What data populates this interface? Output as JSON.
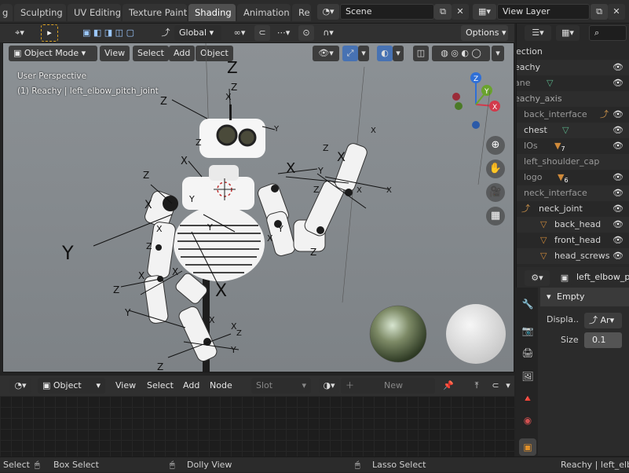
{
  "workspace_tabs": [
    "g",
    "Sculpting",
    "UV Editing",
    "Texture Paint",
    "Shading",
    "Animation",
    "Re"
  ],
  "active_tab": "Shading",
  "scene": {
    "label": "Scene"
  },
  "view_layer": {
    "label": "View Layer"
  },
  "viewport": {
    "transform_orientation": "Global",
    "mode": "Object Mode",
    "menus": [
      "View",
      "Select",
      "Add",
      "Object"
    ],
    "options_label": "Options",
    "overlay_line1": "User Perspective",
    "overlay_line2": "(1) Reachy | left_elbow_pitch_joint",
    "gizmo_labels": {
      "z": "Z",
      "y": "Y",
      "x": "X"
    }
  },
  "outliner": {
    "search_placeholder": "",
    "items": [
      {
        "label": "ection",
        "indent": 0
      },
      {
        "label": "eachy",
        "indent": 0
      },
      {
        "label": "ane",
        "indent": 0
      },
      {
        "label": "eachy_axis",
        "indent": 0
      },
      {
        "label": "back_interface",
        "indent": 1
      },
      {
        "label": "chest",
        "indent": 1
      },
      {
        "label": "IOs",
        "indent": 1,
        "badge": "7"
      },
      {
        "label": "left_shoulder_cap",
        "indent": 1
      },
      {
        "label": "logo",
        "indent": 1,
        "badge": "6"
      },
      {
        "label": "neck_interface",
        "indent": 1
      },
      {
        "label": "neck_joint",
        "indent": 1
      },
      {
        "label": "back_head",
        "indent": 2
      },
      {
        "label": "front_head",
        "indent": 2
      },
      {
        "label": "head_screws",
        "indent": 2
      }
    ]
  },
  "properties": {
    "object_name": "left_elbow_pi",
    "panel_title": "Empty",
    "display_label": "Displa..",
    "display_value": "Ar",
    "size_label": "Size",
    "size_value": "0.1"
  },
  "node_editor": {
    "type": "Object",
    "menus": [
      "View",
      "Select",
      "Add",
      "Node"
    ],
    "slot_label": "Slot",
    "new_label": "New"
  },
  "statusbar": {
    "select": "Select",
    "box_select": "Box Select",
    "dolly_view": "Dolly View",
    "lasso_select": "Lasso Select",
    "info": "Reachy | left_elb"
  }
}
